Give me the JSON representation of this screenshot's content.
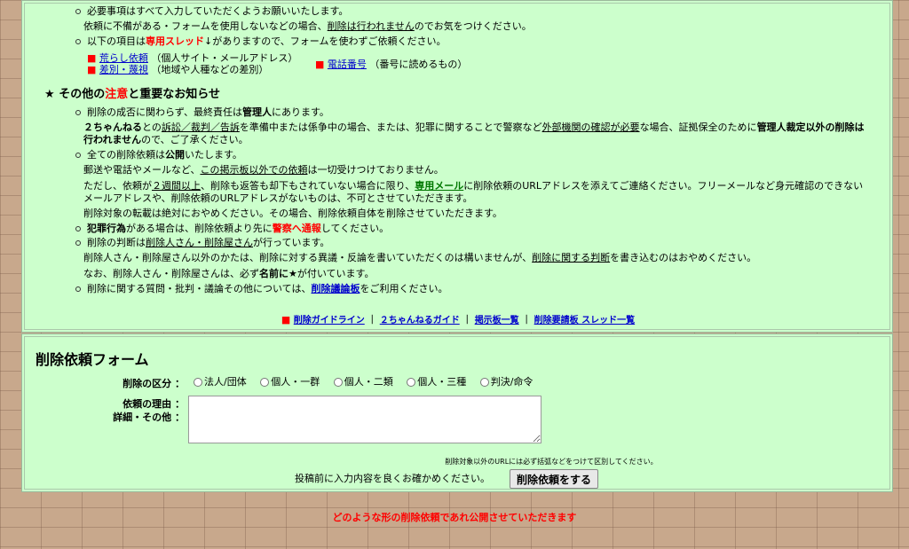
{
  "notice": {
    "line1": "必要事項はすべて入力していただくようお願いいたします。",
    "line2_a": "依頼に不備がある・フォームを使用しないなどの場合、",
    "line2_link": "削除は行われません",
    "line2_b": "のでお気をつけください。",
    "line3_a": "以下の項目は",
    "line3_red": "専用スレッド",
    "line3_b": "↓がありますので、フォームを使わずご依頼ください。",
    "threads": [
      {
        "marker": "■",
        "label": "荒らし依頼",
        "desc": "（個人サイト・メールアドレス）"
      },
      {
        "marker": "■",
        "label": "差別・蔑視",
        "desc": "（地域や人種などの差別）"
      },
      {
        "marker": "■",
        "label": "電話番号",
        "desc": "（番号に読めるもの）"
      }
    ],
    "section_star": "★",
    "section_a": "その他の",
    "section_red": "注意",
    "section_b": "と重要なお知らせ",
    "p1": "削除の成否に関わらず、最終責任は",
    "p1_b": "管理人",
    "p1_c": "にあります。",
    "p2_b1": "２ちゃんねる",
    "p2_a": "との",
    "p2_u": "訴訟／裁判／告訴",
    "p2_c": "を準備中または係争中の場合、または、犯罪に関することで警察など",
    "p2_u2": "外部機関の確認が必要",
    "p2_d": "な場合、証拠保全のために",
    "p2_b2": "管理人裁定以外の削除は行われません",
    "p2_e": "ので、ご了承ください。",
    "p3_a": "全ての削除依頼は",
    "p3_b": "公開",
    "p3_c": "いたします。",
    "p4_a": "郵送や電話やメールなど、",
    "p4_u": "この掲示板以外での依頼",
    "p4_b": "は一切受けつけておりません。",
    "p5_a": "ただし、依頼が",
    "p5_u": "２週間以上",
    "p5_b": "、削除も返答も却下もされていない場合に限り、",
    "p5_g": "専用メール",
    "p5_c": "に削除依頼のURLアドレスを添えてご連絡ください。フリーメールなど身元確認のできないメールアドレスや、削除依頼のURLアドレスがないものは、不可とさせていただきます。",
    "p6": "削除対象の転載は絶対におやめください。その場合、削除依頼自体を削除させていただきます。",
    "p7_b": "犯罪行為",
    "p7_a": "がある場合は、削除依頼より先に",
    "p7_red": "警察へ通報",
    "p7_c": "してください。",
    "p8_a": "削除の判断は",
    "p8_u": "削除人さん・削除屋さん",
    "p8_b": "が行っています。",
    "p9_a": "削除人さん・削除屋さん以外のかたは、削除に対する異議・反論を書いていただくのは構いませんが、",
    "p9_u": "削除に関する判断",
    "p9_b": "を書き込むのはおやめください。",
    "p10_a": "なお、削除人さん・削除屋さんは、必ず",
    "p10_b": "名前に★",
    "p10_c": "が付いています。",
    "p11_a": "削除に関する質問・批判・議論その他については、",
    "p11_link": "削除議論板",
    "p11_b": "をご利用ください。"
  },
  "nav": {
    "marker": "■",
    "items": [
      "削除ガイドライン",
      "２ちゃんねるガイド",
      "掲示板一覧",
      "削除要請板 スレッド一覧"
    ],
    "sep": "｜"
  },
  "form": {
    "title": "削除依頼フォーム",
    "category_label": "削除の区分 ：",
    "categories": [
      "法人/団体",
      "個人・一群",
      "個人・二類",
      "個人・三種",
      "判決/命令"
    ],
    "reason_label1": "依頼の理由 ：",
    "reason_label2": "詳細・その他 ：",
    "reason_value": "",
    "note": "削除対象以外のURLには必ず括弧などをつけて区別してください。",
    "confirm": "投稿前に入力内容を良くお確かめください。",
    "submit_label": "削除依頼をする"
  },
  "footer": "どのような形の削除依頼であれ公開させていただきます",
  "colors": {
    "panel": "#ccffcc",
    "accent_red": "#ff0000",
    "link": "#0000cc",
    "green": "#007700",
    "brick": "#c8a88c"
  }
}
